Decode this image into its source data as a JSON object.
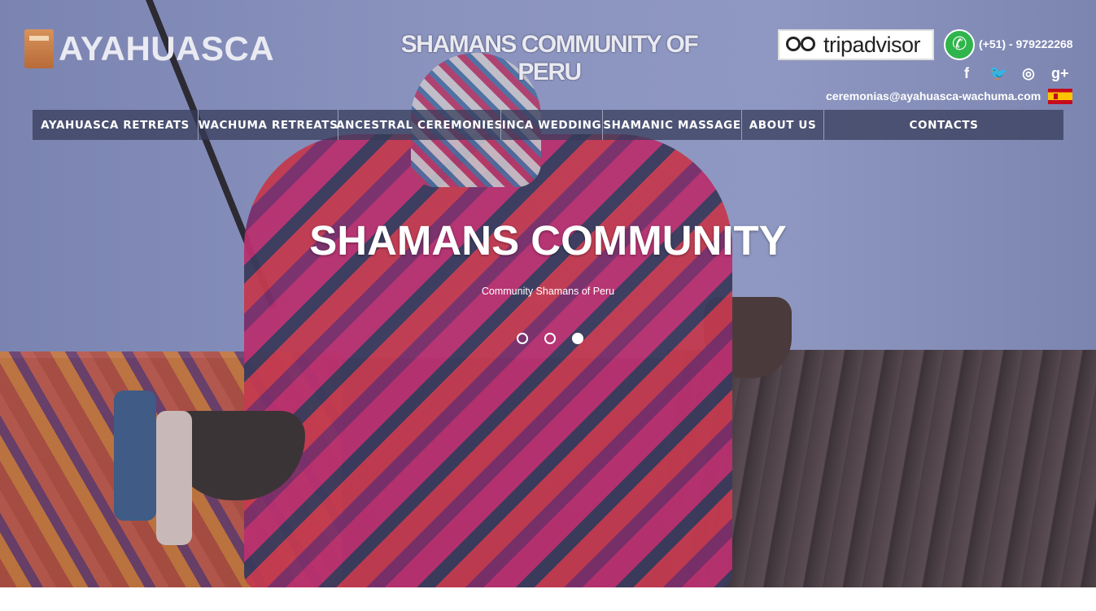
{
  "brand": {
    "name": "AYAHUASCA",
    "icon": "ayahuasca-vessel-icon"
  },
  "tagline": "SHAMANS COMMUNITY OF PERU",
  "contact": {
    "tripadvisor_label": "tripadvisor",
    "phone": "(+51) - 979222268",
    "email": "ceremonias@ayahuasca-wachuma.com",
    "whatsapp_icon": "whatsapp-icon",
    "language_flag": "spain-flag-icon"
  },
  "social": [
    {
      "name": "facebook-icon",
      "glyph": "f"
    },
    {
      "name": "twitter-icon",
      "glyph": "🐦"
    },
    {
      "name": "dribbble-icon",
      "glyph": "◎"
    },
    {
      "name": "google-plus-icon",
      "glyph": "g+"
    }
  ],
  "nav": [
    "AYAHUASCA RETREATS",
    "WACHUMA RETREATS",
    "ANCESTRAL CEREMONIES",
    "INCA WEDDING",
    "SHAMANIC MASSAGE",
    "ABOUT US",
    "CONTACTS"
  ],
  "slider": {
    "title": "SHAMANS COMMUNITY",
    "subtitle": "Community Shamans of Peru",
    "slide_count": 3,
    "active_index": 3
  },
  "colors": {
    "nav_bg": "#373c5a",
    "whatsapp": "#2fb54b"
  }
}
